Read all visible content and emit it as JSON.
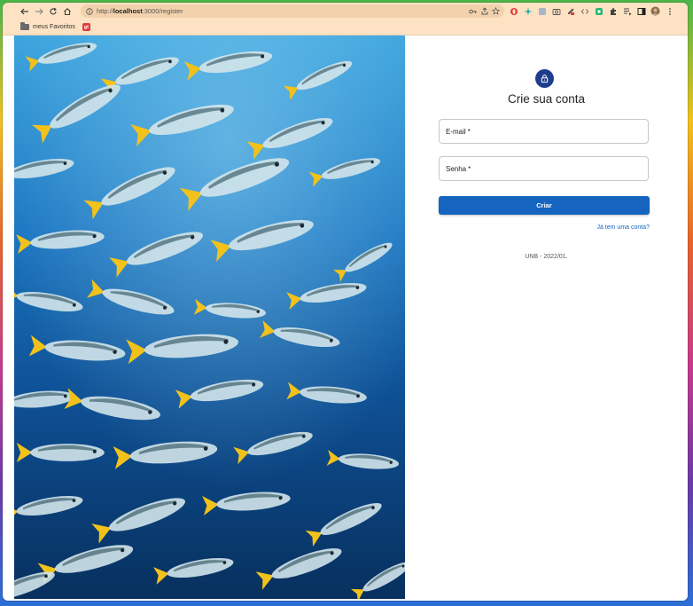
{
  "browser": {
    "url_prefix": "http://",
    "url_host": "localhost",
    "url_rest": ":3000/register",
    "bookmarks": [
      {
        "label": "meus Favoritos"
      }
    ],
    "bookmark_badge": "gt"
  },
  "colors": {
    "toolbar_bg": "#fde3c3",
    "primary": "#1565c0",
    "lock_circle": "#1f3d8f",
    "water_top": "#3aa3dd",
    "water_bottom": "#07305e",
    "fish_body": "#d2e4ea",
    "fish_fin": "#f2c21a"
  },
  "register": {
    "title": "Crie sua conta",
    "email_label": "E-mail",
    "password_label": "Senha",
    "required_mark": "*",
    "submit_label": "Criar",
    "login_link": "Já tem uma conta?",
    "footer": "UNB - 2022/01."
  }
}
